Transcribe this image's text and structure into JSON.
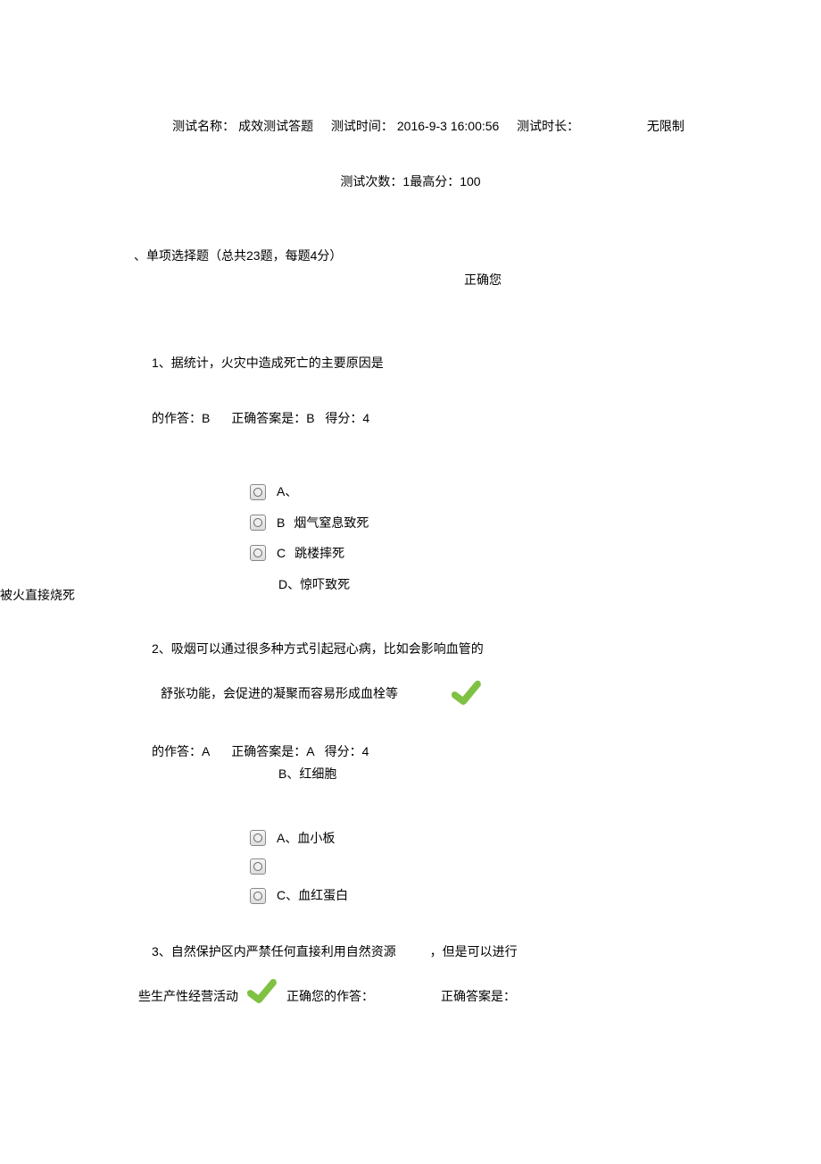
{
  "header": {
    "test_name_label": "测试名称：",
    "test_name": "成效测试答题",
    "test_time_label": "测试时间：",
    "test_time": "2016-9-3 16:00:56",
    "duration_label": "测试时长：",
    "duration_value": "无限制",
    "count_label": "测试次数：",
    "count_value": "1",
    "max_label": "最高分：",
    "max_value": "100"
  },
  "section": {
    "title": "、单项选择题（总共23题，每题4分）",
    "correct_you": "正确您"
  },
  "q1": {
    "text": "1、据统计，火灾中造成死亡的主要原因是",
    "answer_prefix": "的作答：",
    "answer_val": "B",
    "correct_label": "正确答案是：",
    "correct_val": "B",
    "score_label": "得分：",
    "score_val": "4",
    "side": "被火直接烧死",
    "opt_a": "A、",
    "opt_b_label": "B",
    "opt_b_text": "烟气窒息致死",
    "opt_c_label": "C",
    "opt_c_text": "跳楼摔死",
    "opt_d": "D、惊吓致死"
  },
  "q2": {
    "line1": "2、吸烟可以通过很多种方式引起冠心病，比如会影响血管的",
    "line2": "舒张功能，会促进的凝聚而容易形成血栓等",
    "answer_prefix": "的作答：",
    "answer_val": "A",
    "correct_label": "正确答案是：",
    "correct_val": "A",
    "score_label": "得分：",
    "score_val": "4",
    "opt_b": "B、红细胞",
    "opt_a": "A、血小板",
    "opt_c": "C、血红蛋白"
  },
  "q3": {
    "line1a": "3、自然保护区内严禁任何直接利用自然资源",
    "line1b": "，但是可以进行",
    "line2a": "些生产性经营活动",
    "line2b": "正确",
    "line2c": "您的作答：",
    "line2d": "正确答案是："
  }
}
